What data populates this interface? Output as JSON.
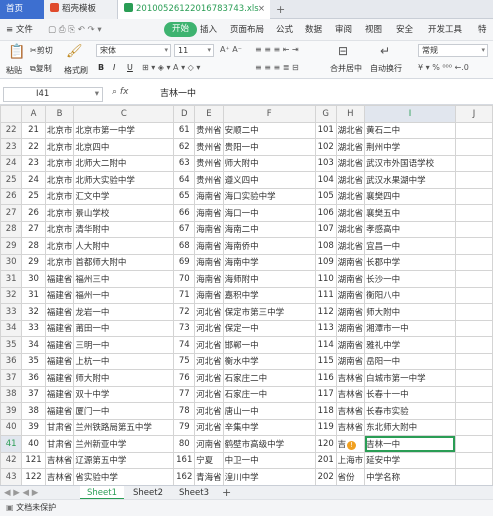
{
  "tabs": {
    "home": "首页",
    "templates": "稻壳模板",
    "file": "20100526122016783743.xls"
  },
  "menu": {
    "file": "文件",
    "items": [
      "开始",
      "插入",
      "页面布局",
      "公式",
      "数据",
      "审阅",
      "视图",
      "安全",
      "开发工具",
      "特"
    ]
  },
  "toolbar": {
    "cut": "剪切",
    "paste": "粘贴",
    "copy": "复制",
    "format_painter": "格式刷",
    "font_name": "宋体",
    "font_size": "11",
    "merge_center": "合并居中",
    "wrap": "自动换行",
    "number_format": "常规",
    "bold": "B",
    "italic": "I",
    "underline": "U",
    "currency": "¥"
  },
  "formula_bar": {
    "cell_ref": "I41",
    "fx": "fx",
    "value": "吉林一中"
  },
  "columns": [
    "A",
    "B",
    "C",
    "D",
    "E",
    "F",
    "G",
    "H",
    "I",
    "J"
  ],
  "selected_row": "41",
  "selected_column": "I",
  "rows": [
    {
      "r": "22",
      "c": [
        "21",
        "北京市",
        "北京市第一中学",
        "61",
        "贵州省",
        "安顺二中",
        "101",
        "湖北省",
        "黄石二中"
      ]
    },
    {
      "r": "23",
      "c": [
        "22",
        "北京市",
        "北京四中",
        "62",
        "贵州省",
        "贵阳一中",
        "102",
        "湖北省",
        "荆州中学"
      ]
    },
    {
      "r": "24",
      "c": [
        "23",
        "北京市",
        "北师大二附中",
        "63",
        "贵州省",
        "师大附中",
        "103",
        "湖北省",
        "武汉市外国语学校"
      ]
    },
    {
      "r": "25",
      "c": [
        "24",
        "北京市",
        "北师大实验中学",
        "64",
        "贵州省",
        "遵义四中",
        "104",
        "湖北省",
        "武汉水果湖中学"
      ]
    },
    {
      "r": "26",
      "c": [
        "25",
        "北京市",
        "汇文中学",
        "65",
        "海南省",
        "海口实验中学",
        "105",
        "湖北省",
        "襄樊四中"
      ]
    },
    {
      "r": "27",
      "c": [
        "26",
        "北京市",
        "景山学校",
        "66",
        "海南省",
        "海口一中",
        "106",
        "湖北省",
        "襄樊五中"
      ]
    },
    {
      "r": "28",
      "c": [
        "27",
        "北京市",
        "清华附中",
        "67",
        "海南省",
        "海南二中",
        "107",
        "湖北省",
        "孝感高中"
      ]
    },
    {
      "r": "29",
      "c": [
        "28",
        "北京市",
        "人大附中",
        "68",
        "海南省",
        "海南侨中",
        "108",
        "湖北省",
        "宜昌一中"
      ]
    },
    {
      "r": "30",
      "c": [
        "29",
        "北京市",
        "首都师大附中",
        "69",
        "海南省",
        "海南中学",
        "109",
        "湖南省",
        "长郡中学"
      ]
    },
    {
      "r": "31",
      "c": [
        "30",
        "福建省",
        "福州三中",
        "70",
        "海南省",
        "海师附中",
        "110",
        "湖南省",
        "长沙一中"
      ]
    },
    {
      "r": "32",
      "c": [
        "31",
        "福建省",
        "福州一中",
        "71",
        "海南省",
        "嘉积中学",
        "111",
        "湖南省",
        "衡阳八中"
      ]
    },
    {
      "r": "33",
      "c": [
        "32",
        "福建省",
        "龙岩一中",
        "72",
        "河北省",
        "保定市第三中学",
        "112",
        "湖南省",
        "师大附中"
      ]
    },
    {
      "r": "34",
      "c": [
        "33",
        "福建省",
        "莆田一中",
        "73",
        "河北省",
        "保定一中",
        "113",
        "湖南省",
        "湘潭市一中"
      ]
    },
    {
      "r": "35",
      "c": [
        "34",
        "福建省",
        "三明一中",
        "74",
        "河北省",
        "邯郸一中",
        "114",
        "湖南省",
        "雅礼中学"
      ]
    },
    {
      "r": "36",
      "c": [
        "35",
        "福建省",
        "上杭一中",
        "75",
        "河北省",
        "衡水中学",
        "115",
        "湖南省",
        "岳阳一中"
      ]
    },
    {
      "r": "37",
      "c": [
        "36",
        "福建省",
        "师大附中",
        "76",
        "河北省",
        "石家庄二中",
        "116",
        "吉林省",
        "白城市第一中学"
      ]
    },
    {
      "r": "38",
      "c": [
        "37",
        "福建省",
        "双十中学",
        "77",
        "河北省",
        "石家庄一中",
        "117",
        "吉林省",
        "长春十一中"
      ]
    },
    {
      "r": "39",
      "c": [
        "38",
        "福建省",
        "厦门一中",
        "78",
        "河北省",
        "唐山一中",
        "118",
        "吉林省",
        "长春市实验"
      ]
    },
    {
      "r": "40",
      "c": [
        "39",
        "甘肃省",
        "兰州铁路局第五中学",
        "79",
        "河北省",
        "辛集中学",
        "119",
        "吉林省",
        "东北师大附中"
      ]
    },
    {
      "r": "41",
      "c": [
        "40",
        "甘肃省",
        "兰州新亚中学",
        "80",
        "河南省",
        "鹤壁市高级中学",
        "120",
        "吉",
        "吉林一中"
      ]
    },
    {
      "r": "42",
      "c": [
        "121",
        "吉林省",
        "辽源第五中学",
        "161",
        "宁夏",
        "中卫一中",
        "201",
        "上海市",
        "延安中学"
      ]
    },
    {
      "r": "43",
      "c": [
        "122",
        "吉林省",
        "省实验中学",
        "162",
        "青海省",
        "湟川中学",
        "202",
        "省份",
        "中学名称"
      ]
    },
    {
      "r": "44",
      "c": [
        "123",
        "吉林省",
        "四平市第一高级中学",
        "163",
        "青海省",
        "西宁十四中",
        "203",
        "四川省",
        "成都七中"
      ]
    },
    {
      "r": "45",
      "c": [
        "124",
        "吉林省",
        "松原市油田高中",
        "164",
        "青海省",
        "西宁五中",
        "204",
        "四川省",
        "成都实验外国语学校"
      ]
    }
  ],
  "sheets": [
    "Sheet1",
    "Sheet2",
    "Sheet3"
  ],
  "status": {
    "protect": "文档未保护"
  },
  "colors": {
    "accent": "#2a9d55",
    "home_tab": "#3d6fd0",
    "warn": "#f0a020"
  }
}
